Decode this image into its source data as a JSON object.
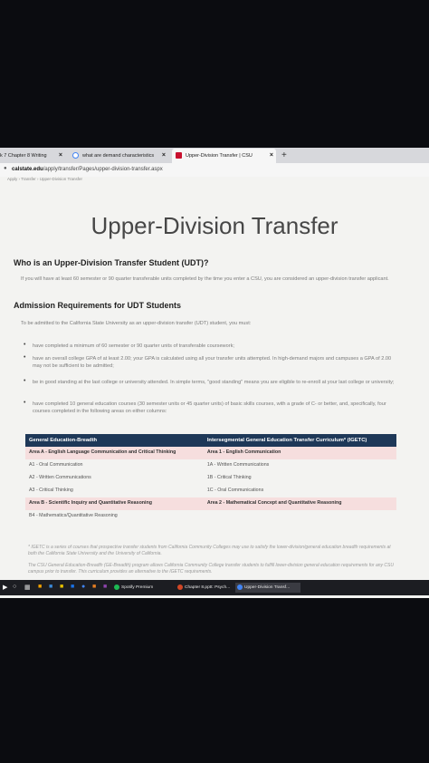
{
  "browser": {
    "tabs": [
      {
        "label": "k 7 Chapter 8 Writing",
        "close": "×"
      },
      {
        "label": "what are demand characteristics",
        "close": "×"
      },
      {
        "label": "Upper-Division Transfer | CSU",
        "close": "×"
      }
    ],
    "new_tab": "+",
    "url_domain": "calstate.edu",
    "url_path": "/apply/transfer/Pages/upper-division-transfer.aspx",
    "breadcrumb": "Apply  ›  Transfer  ›  Upper-Division Transfer"
  },
  "page": {
    "title": "Upper-Division Transfer",
    "q_heading": "Who is an Upper-Division Transfer Student (UDT)?",
    "q_text": "If you will have at least 60 semester or 90 quarter transferable units completed by the time you enter a CSU, you are considered an upper-division transfer applicant.",
    "req_heading": "Admission Requirements for UDT Students",
    "req_intro": "To be admitted to the California State University as an upper-division transfer (UDT) student, you must:",
    "requirements": [
      "have completed a minimum of 60 semester or 90 quarter units of transferable coursework;",
      "have an overall college GPA of at least 2.00; your GPA is calculated using all your transfer units attempted. In high-demand majors and campuses a GPA of 2.00 may not be sufficient to be admitted;",
      "be in good standing at the last college or university attended. In simple terms, \"good standing\" means you are eligible to re-enroll at your last college or university;",
      "have completed 10 general education courses (30 semester units or 45 quarter units) of basic skills courses, with a grade of C- or better, and, specifically, four courses completed in the following areas on either columns:"
    ],
    "table": {
      "headers": [
        "General Education-Breadth",
        "Intersegmental General Education Transfer Curriculum* (IGETC)"
      ],
      "rows": [
        [
          "Area A - English Language Communication and Critical Thinking",
          "Area 1 - English Communication"
        ],
        [
          "A1 - Oral Communication",
          "1A - Written Communications"
        ],
        [
          "A2 - Written Communications",
          "1B - Critical Thinking"
        ],
        [
          "A3 - Critical Thinking",
          "1C - Oral Communications"
        ],
        [
          "Area B - Scientific Inquiry and Quantitative Reasoning",
          "Area 2 - Mathematical Concept and Quantitative Reasoning"
        ],
        [
          "B4 - Mathematics/Quantitative Reasoning",
          ""
        ]
      ]
    },
    "footnote_1": "* IGETC is a series of courses that prospective transfer students from California Community Colleges may use to satisfy the lower-division/general education breadth requirements at both the California State University and the University of California.",
    "footnote_2": "The CSU General Education-Breadth (GE-Breadth) program allows California Community College transfer students to fulfill lower-division general education requirements for any CSU campus prior to transfer. This curriculum provides an alternative to the IGETC requirements."
  },
  "taskbar": {
    "apps": [
      {
        "label": "Spotify Premium"
      },
      {
        "label": "Chapter 8.pptt: Psych..."
      },
      {
        "label": "Upper-Division Transf..."
      }
    ]
  },
  "colors": {
    "table_header": "#1e3858",
    "highlight_row": "#f6dede",
    "page_bg": "#f3f3f1"
  }
}
